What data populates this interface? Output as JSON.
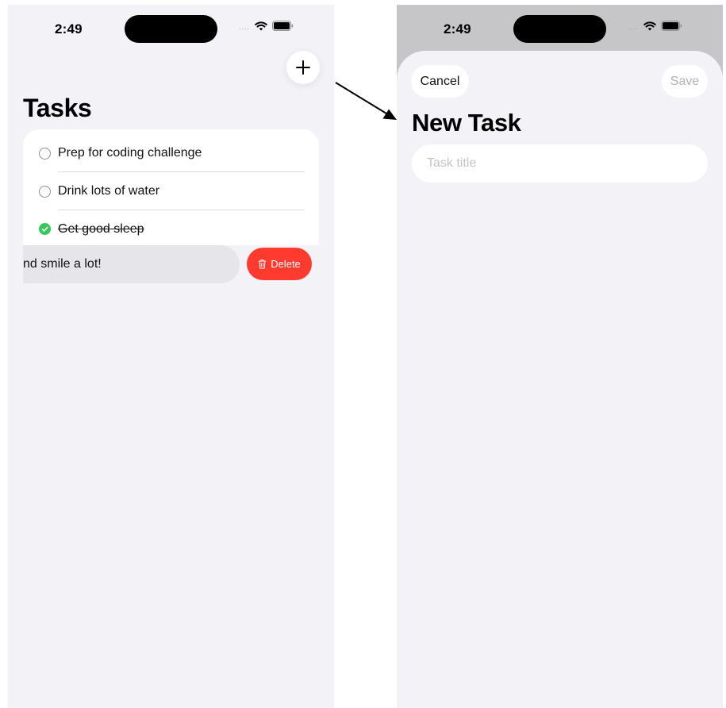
{
  "left_screen": {
    "status_bar": {
      "time": "2:49",
      "signal": "....",
      "icons": [
        "wifi-icon",
        "battery-icon"
      ]
    },
    "add_button_icon": "plus-icon",
    "title": "Tasks",
    "tasks": [
      {
        "label": "Prep for coding challenge",
        "completed": false
      },
      {
        "label": "Drink lots of water",
        "completed": false
      },
      {
        "label": "Get good sleep",
        "completed": true
      }
    ],
    "swiped_task": {
      "label": "nd smile a lot!"
    },
    "delete_button": {
      "label": "Delete",
      "icon": "trash-icon"
    }
  },
  "transition_arrow": "arrow-icon",
  "right_screen": {
    "status_bar": {
      "time": "2:49",
      "signal": "....",
      "icons": [
        "wifi-icon",
        "battery-icon"
      ]
    },
    "cancel_label": "Cancel",
    "save_label": "Save",
    "title": "New Task",
    "input": {
      "value": "",
      "placeholder": "Task title"
    }
  },
  "colors": {
    "background": "#f2f2f7",
    "delete": "#ff3b30",
    "check": "#34c759",
    "placeholder": "#c4c4c8",
    "sheet_backdrop": "#c6c6c8"
  }
}
